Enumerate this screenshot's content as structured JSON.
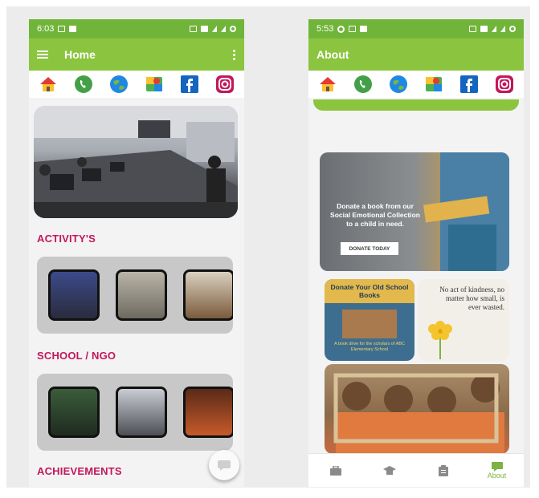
{
  "colors": {
    "status_bar": "#70b53a",
    "app_bar": "#8bc53f",
    "section_title": "#c2185b",
    "page_background": "#f3f3f3",
    "nav_active": "#7cb342"
  },
  "phone_home": {
    "status_bar": {
      "time": "6:03"
    },
    "app_bar": {
      "title": "Home",
      "menu_icon": "hamburger-icon",
      "overflow_icon": "more-vert-icon"
    },
    "shortcuts": [
      "home-icon",
      "phone-icon",
      "globe-icon",
      "maps-icon",
      "facebook-icon",
      "instagram-icon"
    ],
    "sections": [
      {
        "title": "ACTIVITY'S",
        "thumbnails": 3
      },
      {
        "title": "SCHOOL / NGO",
        "thumbnails": 3
      },
      {
        "title": "ACHIEVEMENTS"
      }
    ],
    "fab_icon": "chat-icon"
  },
  "phone_about": {
    "status_bar": {
      "time": "5:53"
    },
    "app_bar": {
      "title": "About"
    },
    "shortcuts": [
      "home-icon",
      "phone-icon",
      "globe-icon",
      "maps-icon",
      "facebook-icon",
      "instagram-icon"
    ],
    "donate_card": {
      "message": "Donate a book from our Social Emotional Collection to a child in need.",
      "button": "DONATE TODAY"
    },
    "books_card": {
      "title": "Donate Your Old School Books",
      "caption": "A book drive for the scholars of ABC Elementary School"
    },
    "quote_card": {
      "quote": "No act of kindness, no matter how small, is ever wasted."
    },
    "bottom_nav": [
      {
        "icon": "briefcase-icon",
        "label": ""
      },
      {
        "icon": "graduation-cap-icon",
        "label": ""
      },
      {
        "icon": "clipboard-icon",
        "label": ""
      },
      {
        "icon": "chat-icon",
        "label": "About",
        "active": true
      }
    ]
  }
}
